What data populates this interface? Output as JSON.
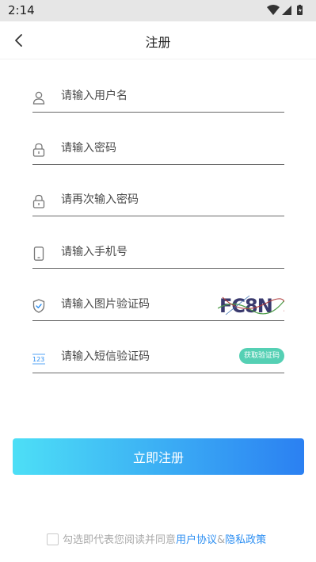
{
  "status_bar": {
    "time": "2:14"
  },
  "header": {
    "title": "注册",
    "back_icon": "chevron-left-icon"
  },
  "form": {
    "username": {
      "placeholder": "请输入用户名",
      "icon": "user-icon"
    },
    "password": {
      "placeholder": "请输入密码",
      "icon": "lock-icon"
    },
    "confirm_password": {
      "placeholder": "请再次输入密码",
      "icon": "lock-icon"
    },
    "phone": {
      "placeholder": "请输入手机号",
      "icon": "phone-icon"
    },
    "image_code": {
      "placeholder": "请输入图片验证码",
      "icon": "shield-check-icon",
      "captcha_text": "FC8N"
    },
    "sms_code": {
      "placeholder": "请输入短信验证码",
      "icon": "numeric-keypad-icon",
      "button_label": "获取验证码"
    }
  },
  "submit_label": "立即注册",
  "agreement": {
    "prefix": "勾选即代表您阅读并同意",
    "user_agreement": "用户协议",
    "ampersand": "&",
    "privacy_policy": "隐私政策"
  },
  "colors": {
    "accent": "#2b8ef2",
    "sms_button": "#55d0b4",
    "gradient_start": "#4ddff6",
    "gradient_end": "#2b80f2"
  }
}
